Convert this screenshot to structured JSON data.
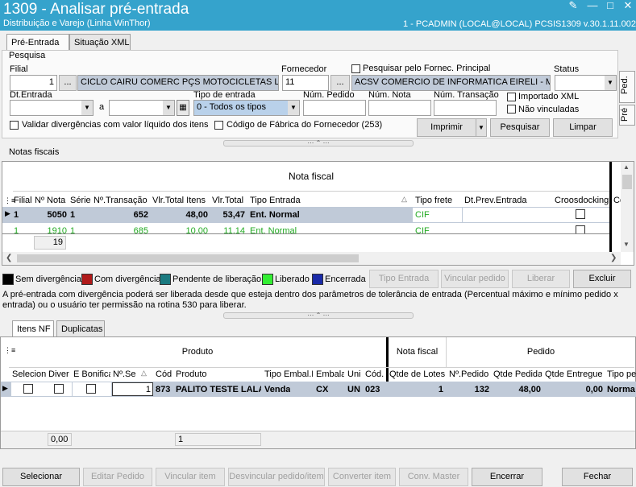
{
  "window": {
    "title": "1309 - Analisar pré-entrada",
    "subtitle": "Distribuição e Varejo (Linha WinThor)",
    "connection": "1 - PCADMIN (LOCAL@LOCAL)    PCSIS1309   v.30.1.11.002"
  },
  "tabs": {
    "pre_entrada": "Pré-Entrada",
    "situacao_xml": "Situação XML"
  },
  "side_tabs": {
    "ped": "Ped.",
    "pre": "Pré"
  },
  "search": {
    "group_label": "Pesquisa",
    "filial_label": "Filial",
    "filial_value": "1",
    "filial_name": "CICLO CAIRU COMERC PÇS MOTOCICLETAS LTDA",
    "fornecedor_label": "Fornecedor",
    "fornecedor_value": "11",
    "fornecedor_name": "ACSV COMERCIO DE INFORMATICA EIRELI - ME",
    "fornec_principal_label": "Pesquisar pelo Fornec. Principal",
    "status_label": "Status",
    "status_value": "",
    "dt_entrada_label": "Dt.Entrada",
    "a_label": "a",
    "tipo_entrada_label": "Tipo de entrada",
    "tipo_entrada_value": "0 - Todos os tipos",
    "num_pedido_label": "Núm. Pedido",
    "num_nota_label": "Núm. Nota",
    "num_transacao_label": "Núm. Transação",
    "importado_xml_label": "Importado XML",
    "nao_vinculadas_label": "Não vinculadas",
    "validar_label": "Validar divergências com valor líquido dos itens",
    "codigo_fabrica_label": "Código de Fábrica do Fornecedor (253)",
    "imprimir": "Imprimir",
    "pesquisar": "Pesquisar",
    "limpar": "Limpar",
    "ellipsis": "..."
  },
  "notas": {
    "group_label": "Notas fiscais",
    "band_title": "Nota fiscal",
    "columns": [
      "Filial",
      "Nº Nota",
      "Série",
      "Nº.Transação",
      "Vlr.Total Itens",
      "Vlr.Total",
      "Tipo Entrada",
      "Tipo frete",
      "Dt.Prev.Entrada",
      "Croosdocking",
      "Co"
    ],
    "rows": [
      {
        "filial": "1",
        "nota": "5050",
        "serie": "1",
        "transacao": "652",
        "vlr_itens": "48,00",
        "vlr_total": "53,47",
        "tipo": "Ent. Normal",
        "frete": "CIF"
      },
      {
        "filial": "1",
        "nota": "1910",
        "serie": "1",
        "transacao": "685",
        "vlr_itens": "10,00",
        "vlr_total": "11,14",
        "tipo": "Ent. Normal",
        "frete": "CIF"
      }
    ],
    "footer_count": "19"
  },
  "legend": {
    "sem": "Sem divergência",
    "com": "Com divergência",
    "pendente": "Pendente de liberação",
    "liberado": "Liberado",
    "encerrada": "Encerrada",
    "colors": {
      "sem": "#000000",
      "com": "#b01a1a",
      "pendente": "#1a7a80",
      "liberado": "#33ee33",
      "encerrada": "#1a2aa8"
    }
  },
  "actions": {
    "tipo_entrada": "Tipo Entrada",
    "vincular_pedido": "Vincular pedido",
    "liberar": "Liberar",
    "excluir": "Excluir"
  },
  "info_text": "A pré-entrada com divergência poderá ser liberada desde que esteja dentro dos parâmetros de tolerância de entrada (Percentual máximo e mínimo pedido x entrada) ou o usuário ter permissão na rotina 530 para liberar.",
  "itens_tabs": {
    "itens_nf": "Itens NF",
    "duplicatas": "Duplicatas"
  },
  "itens": {
    "bands": {
      "produto": "Produto",
      "nota_fiscal": "Nota fiscal",
      "pedido": "Pedido"
    },
    "columns": [
      "Selecion",
      "Diver",
      "E Bonifica",
      "Nº.Se",
      "Cód",
      "Produto",
      "Tipo Embal.F",
      "Embala",
      "Uni",
      "Cód.",
      "Qtde de Lotes",
      "Nº.Pedido",
      "Qtde Pedida",
      "Qtde Entregue",
      "Tipo pe"
    ],
    "row": {
      "seq": "1",
      "cod": "873",
      "produto": "PALITO TESTE LALA",
      "tipo_embal": "Venda",
      "embala": "CX",
      "uni": "UN",
      "cod2": "023",
      "lotes": "1",
      "pedido": "132",
      "qtde_pedida": "48,00",
      "qtde_entregue": "0,00",
      "tipo_pe": "Norma"
    },
    "footer_a": "0,00",
    "footer_b": "1"
  },
  "bottom": {
    "selecionar": "Selecionar",
    "editar_pedido": "Editar Pedido",
    "vincular_item": "Vincular item",
    "desvincular": "Desvincular pedido/item",
    "converter_item": "Converter item",
    "conv_master": "Conv. Master",
    "encerrar": "Encerrar",
    "fechar": "Fechar"
  }
}
